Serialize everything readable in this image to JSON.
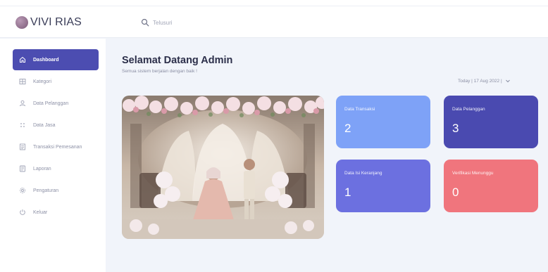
{
  "app": {
    "logo_text": "VIVI RIAS"
  },
  "search": {
    "placeholder": "Telusuri"
  },
  "sidebar": {
    "items": [
      {
        "label": "Dashboard",
        "icon": "home-icon",
        "active": true
      },
      {
        "label": "Kategori",
        "icon": "grid-icon",
        "active": false
      },
      {
        "label": "Data Pelanggan",
        "icon": "user-icon",
        "active": false
      },
      {
        "label": "Data Jasa",
        "icon": "dots-icon",
        "active": false
      },
      {
        "label": "Transaksi Pemesanan",
        "icon": "list-icon",
        "active": false
      },
      {
        "label": "Laporan",
        "icon": "report-icon",
        "active": false
      },
      {
        "label": "Pengaturan",
        "icon": "gear-icon",
        "active": false
      },
      {
        "label": "Keluar",
        "icon": "logout-icon",
        "active": false
      }
    ]
  },
  "main": {
    "title": "Selamat Datang Admin",
    "subtitle": "Semua sistem berjalan dengan baik !",
    "date_filter": "Today | 17 Aug 2022 |"
  },
  "cards": [
    {
      "label": "Data Transaksi",
      "value": "2",
      "color": "#7ea2f7"
    },
    {
      "label": "Data Pelanggan",
      "value": "3",
      "color": "#4a4ab0"
    },
    {
      "label": "Data Isi Keranjang",
      "value": "1",
      "color": "#6c70e0"
    },
    {
      "label": "Verifikasi Menunggu",
      "value": "0",
      "color": "#f0757d"
    }
  ],
  "colors": {
    "accent": "#4c4db1",
    "background": "#f1f4fa"
  }
}
